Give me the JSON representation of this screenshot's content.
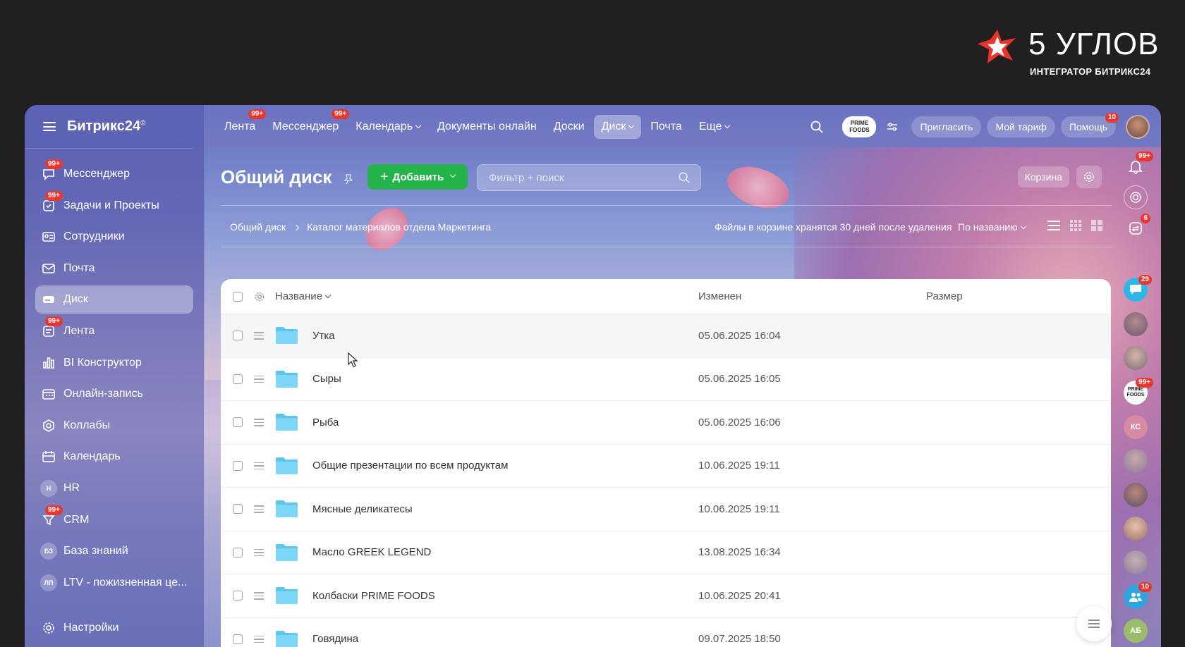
{
  "brand": {
    "title": "5 УГЛОВ",
    "subtitle": "ИНТЕГРАТОР БИТРИКС24"
  },
  "app": {
    "logo": "Битрикс24",
    "logo_mark": "©"
  },
  "sidebar": {
    "items": [
      {
        "label": "Мессенджер",
        "icon": "messenger-icon",
        "badge": "99+"
      },
      {
        "label": "Задачи и Проекты",
        "icon": "tasks-icon",
        "badge": "99+"
      },
      {
        "label": "Сотрудники",
        "icon": "employees-icon",
        "badge": ""
      },
      {
        "label": "Почта",
        "icon": "mail-icon",
        "badge": ""
      },
      {
        "label": "Диск",
        "icon": "disk-icon",
        "badge": "",
        "active": true
      },
      {
        "label": "Лента",
        "icon": "feed-icon",
        "badge": "99+"
      },
      {
        "label": "BI Конструктор",
        "icon": "bi-chart-icon",
        "badge": ""
      },
      {
        "label": "Онлайн-запись",
        "icon": "booking-icon",
        "badge": ""
      },
      {
        "label": "Коллабы",
        "icon": "collab-icon",
        "badge": ""
      },
      {
        "label": "Календарь",
        "icon": "calendar-icon",
        "badge": ""
      },
      {
        "label": "HR",
        "icon": "H",
        "badge": ""
      },
      {
        "label": "CRM",
        "icon": "crm-icon",
        "badge": "99+"
      },
      {
        "label": "База знаний",
        "icon": "БЗ",
        "badge": ""
      },
      {
        "label": "LTV - пожизненная це...",
        "icon": "ЛП",
        "badge": ""
      }
    ],
    "settings": "Настройки"
  },
  "topnav": {
    "items": [
      {
        "label": "Лента",
        "badge": "99+"
      },
      {
        "label": "Мессенджер",
        "badge": "99+"
      },
      {
        "label": "Календарь",
        "dropdown": true
      },
      {
        "label": "Документы онлайн"
      },
      {
        "label": "Доски"
      },
      {
        "label": "Диск",
        "dropdown": true,
        "active": true
      },
      {
        "label": "Почта"
      },
      {
        "label": "Еще",
        "dropdown": true
      }
    ],
    "prime_logo": [
      "PRIME",
      "FOODS"
    ],
    "invite": "Пригласить",
    "tariff": "Мой тариф",
    "help": "Помощь",
    "help_badge": "10"
  },
  "toolbar": {
    "title": "Общий диск",
    "add": "Добавить",
    "search_placeholder": "Фильтр + поиск",
    "trash": "Корзина"
  },
  "breadcrumb": [
    "Общий диск",
    "Каталог материалов отдела Маркетинга"
  ],
  "hint": "Файлы в корзине хранятся 30 дней после удаления",
  "sort": "По названию",
  "table": {
    "headers": {
      "name": "Название",
      "modified": "Изменен",
      "size": "Размер"
    },
    "rows": [
      {
        "name": "Утка",
        "modified": "05.06.2025 16:04",
        "size": ""
      },
      {
        "name": "Сыры",
        "modified": "05.06.2025 16:05",
        "size": ""
      },
      {
        "name": "Рыба",
        "modified": "05.06.2025 16:06",
        "size": ""
      },
      {
        "name": "Общие презентации по всем продуктам",
        "modified": "10.06.2025 19:11",
        "size": ""
      },
      {
        "name": "Мясные деликатесы",
        "modified": "10.06.2025 19:11",
        "size": ""
      },
      {
        "name": "Масло GREEK LEGEND",
        "modified": "13.08.2025 16:34",
        "size": ""
      },
      {
        "name": "Колбаски PRIME FOODS",
        "modified": "10.06.2025 20:41",
        "size": ""
      },
      {
        "name": "Говядина",
        "modified": "09.07.2025 18:50",
        "size": ""
      }
    ]
  },
  "rail": {
    "notifications_badge": "99+",
    "sync_badge": "6",
    "chat_badge": "29",
    "prime_badge": "99+",
    "group_badge": "10",
    "initials": [
      "КС",
      "АБ"
    ]
  },
  "colors": {
    "accent_green": "#24b44b",
    "badge_red": "#e8372f",
    "folder": "#6fcff3"
  }
}
